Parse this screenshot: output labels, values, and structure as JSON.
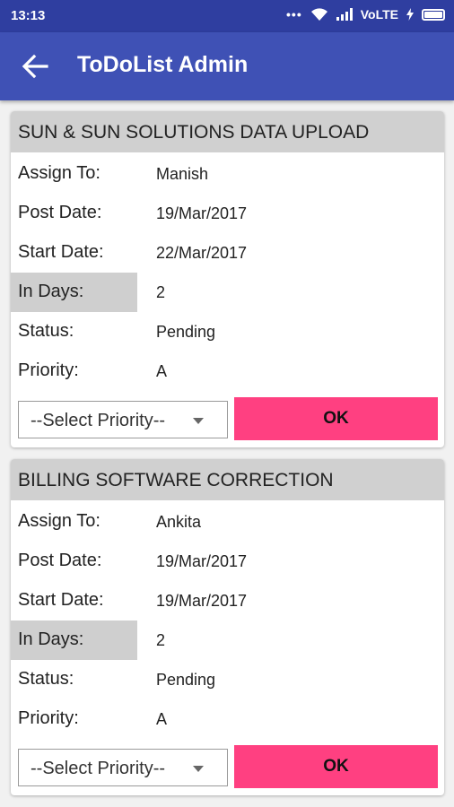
{
  "status_bar": {
    "time": "13:13",
    "dots": "•••",
    "network": "VoLTE"
  },
  "app_bar": {
    "title": "ToDoList Admin",
    "back_icon": "arrow-back-icon"
  },
  "labels": {
    "assign_to": "Assign To:",
    "post_date": "Post Date:",
    "start_date": "Start Date:",
    "in_days": "In Days:",
    "status": "Status:",
    "priority": "Priority:"
  },
  "colors": {
    "status_bar": "#2f3ea0",
    "app_bar": "#3f51b5",
    "ok_button": "#ff4081",
    "card_header": "#d0d0d0"
  },
  "tasks": [
    {
      "title": "SUN & SUN SOLUTIONS DATA UPLOAD",
      "assign_to": "Manish",
      "post_date": "19/Mar/2017",
      "start_date": "22/Mar/2017",
      "in_days": "2",
      "status": "Pending",
      "priority": "A",
      "select_placeholder": "--Select Priority--",
      "ok_label": "OK"
    },
    {
      "title": "BILLING SOFTWARE CORRECTION",
      "assign_to": "Ankita",
      "post_date": "19/Mar/2017",
      "start_date": "19/Mar/2017",
      "in_days": "2",
      "status": "Pending",
      "priority": "A",
      "select_placeholder": "--Select Priority--",
      "ok_label": "OK"
    }
  ]
}
